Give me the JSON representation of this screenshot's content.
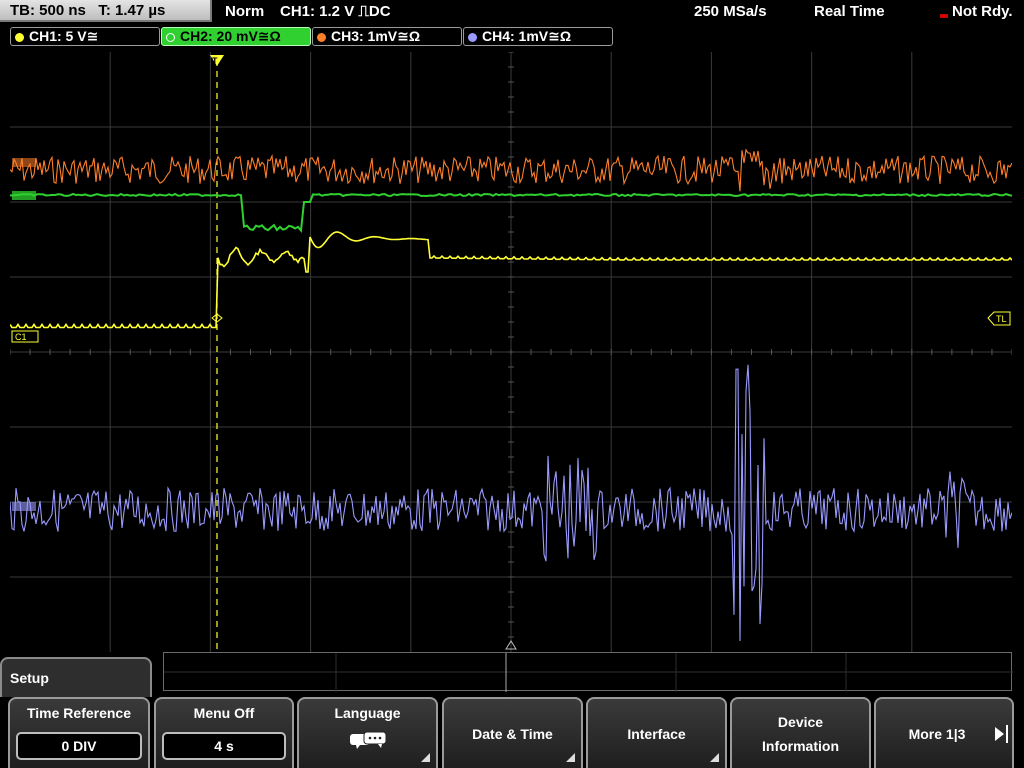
{
  "status_bar": {
    "timebase": "TB: 500 ns",
    "trigger_time": "T: 1.47 µs",
    "mode": "Norm",
    "trigger_info": "CH1: 1.2 V ⎍DC",
    "sample_rate": "250 MSa/s",
    "acq_mode": "Real Time",
    "state": "Not Rdy."
  },
  "channels": [
    {
      "label": "CH1: 5 V≅",
      "color": "#ffff33"
    },
    {
      "label": "CH2: 20 mV≅Ω",
      "color": "#2fd02f",
      "active": true
    },
    {
      "label": "CH3: 1mV≅Ω",
      "color": "#ff7f2a"
    },
    {
      "label": "CH4: 1mV≅Ω",
      "color": "#9a9aff"
    }
  ],
  "display": {
    "trigger_marker": "T",
    "trigger_level_marker": "TL",
    "ch1_marker": "C1",
    "colors": {
      "ch1": "#ffff33",
      "ch2": "#2fd02f",
      "ch3": "#ff7f2a",
      "ch4": "#9a9aff",
      "grid": "#3a3a3a"
    }
  },
  "menu": {
    "title": "Setup",
    "softkeys": [
      {
        "label": "Time Reference",
        "value": "0 DIV"
      },
      {
        "label": "Menu Off",
        "value": "4 s"
      },
      {
        "label": "Language",
        "icon": "speech-bubbles-icon"
      },
      {
        "label": "Date & Time"
      },
      {
        "label": "Interface"
      },
      {
        "label_line1": "Device",
        "label_line2": "Information"
      },
      {
        "label": "More 1|3"
      }
    ]
  }
}
